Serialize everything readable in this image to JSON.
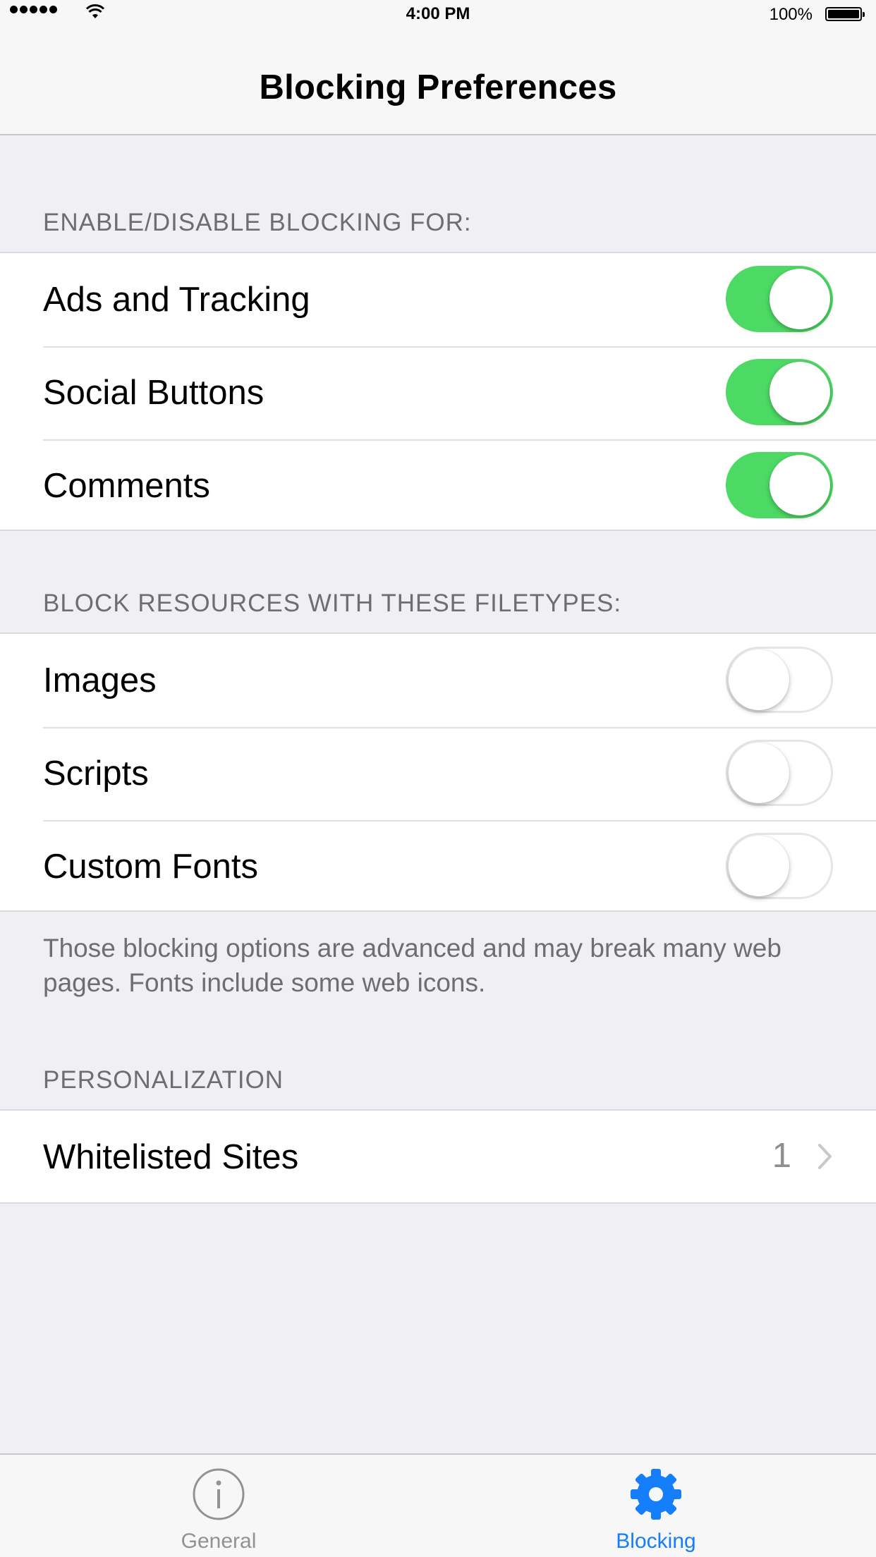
{
  "status_bar": {
    "time": "4:00 PM",
    "battery_percent": "100%",
    "battery_level": 1.0
  },
  "nav": {
    "title": "Blocking Preferences"
  },
  "sections": {
    "blocking_for": {
      "header": "ENABLE/DISABLE BLOCKING FOR:",
      "rows": [
        {
          "label": "Ads and Tracking",
          "on": true
        },
        {
          "label": "Social Buttons",
          "on": true
        },
        {
          "label": "Comments",
          "on": true
        }
      ]
    },
    "filetypes": {
      "header": "BLOCK RESOURCES WITH THESE FILETYPES:",
      "rows": [
        {
          "label": "Images",
          "on": false
        },
        {
          "label": "Scripts",
          "on": false
        },
        {
          "label": "Custom Fonts",
          "on": false
        }
      ],
      "footer": "Those blocking options are advanced and may break many web pages. Fonts include some web icons."
    },
    "personalization": {
      "header": "PERSONALIZATION",
      "row": {
        "label": "Whitelisted Sites",
        "detail": "1"
      }
    }
  },
  "tabbar": {
    "tabs": [
      {
        "label": "General",
        "icon": "info-icon",
        "selected": false
      },
      {
        "label": "Blocking",
        "icon": "gear-icon",
        "selected": true
      }
    ]
  },
  "colors": {
    "switch_on": "#4cd964",
    "tint": "#147efb",
    "background": "#efeff4"
  }
}
